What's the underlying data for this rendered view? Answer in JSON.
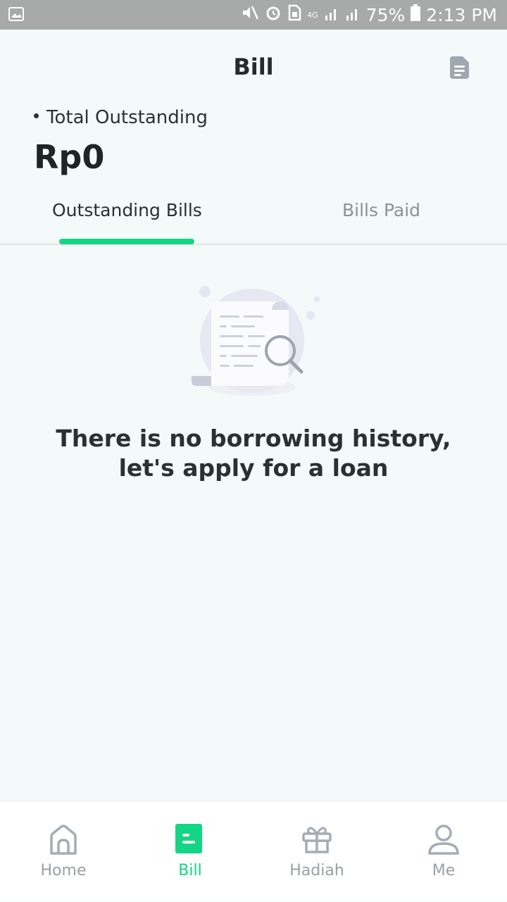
{
  "status_bar": {
    "battery": "75%",
    "time": "2:13 PM",
    "network": "4G"
  },
  "header": {
    "title": "Bill",
    "action_icon": "document-icon"
  },
  "summary": {
    "label": "Total Outstanding",
    "amount": "Rp0"
  },
  "tabs": [
    {
      "label": "Outstanding Bills",
      "active": true
    },
    {
      "label": "Bills Paid",
      "active": false
    }
  ],
  "empty_state": {
    "message": "There is no borrowing history, let's apply for a loan",
    "illustration": "document-search-icon"
  },
  "bottom_nav": {
    "items": [
      {
        "label": "Home",
        "icon": "home-icon",
        "active": false
      },
      {
        "label": "Bill",
        "icon": "bill-icon",
        "active": true
      },
      {
        "label": "Hadiah",
        "icon": "gift-icon",
        "active": false
      },
      {
        "label": "Me",
        "icon": "profile-icon",
        "active": false
      }
    ]
  },
  "colors": {
    "accent": "#12d684",
    "background": "#f4f9f9",
    "status_bar": "#a7aaa9"
  }
}
